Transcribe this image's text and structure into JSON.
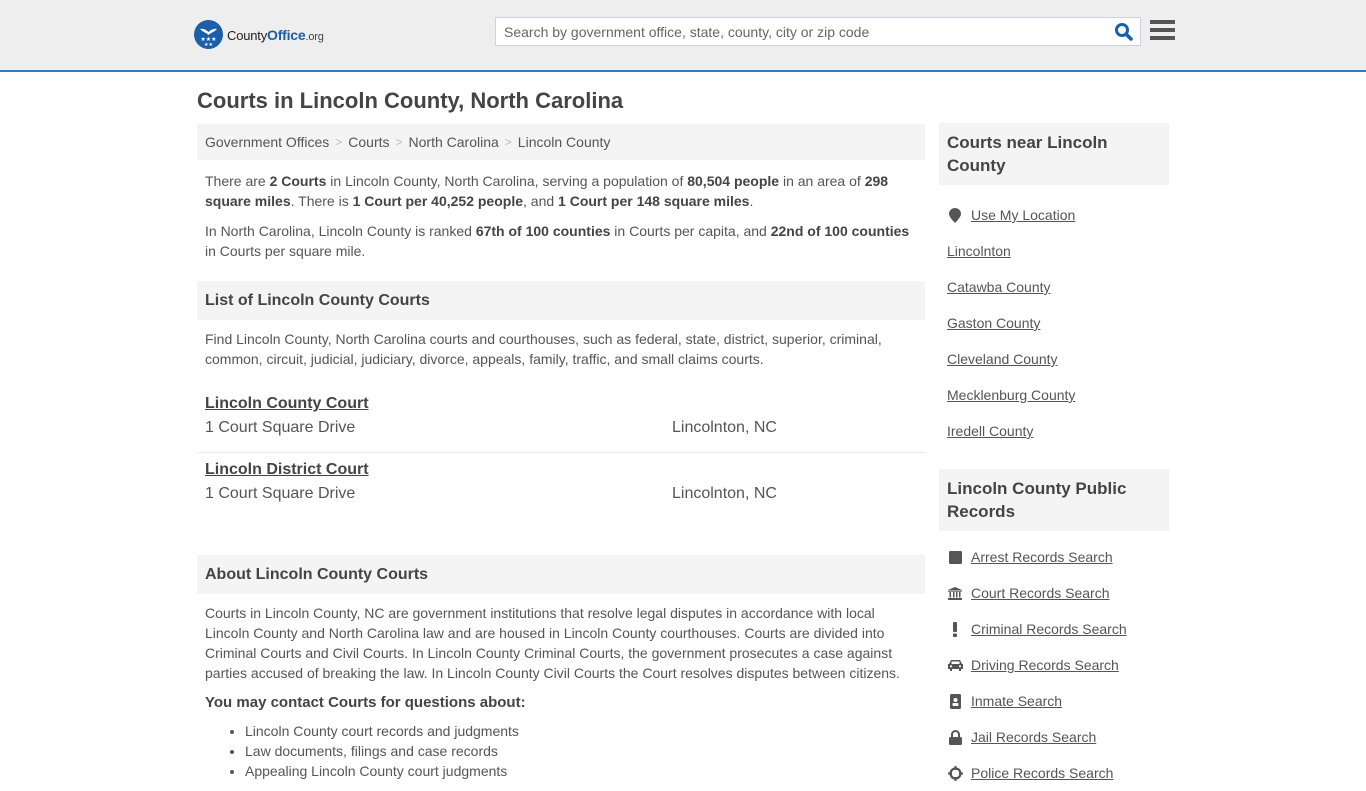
{
  "header": {
    "logo": {
      "county": "County",
      "office": "Office",
      "org": ".org"
    },
    "search_placeholder": "Search by government office, state, county, city or zip code",
    "accent_color": "#1a5fa8"
  },
  "page_title": "Courts in Lincoln County, North Carolina",
  "breadcrumb": [
    {
      "label": "Government Offices"
    },
    {
      "label": "Courts"
    },
    {
      "label": "North Carolina"
    },
    {
      "label": "Lincoln County"
    }
  ],
  "summary": {
    "p1": {
      "t1": "There are ",
      "b1": "2 Courts",
      "t2": " in Lincoln County, North Carolina, serving a population of ",
      "b2": "80,504 people",
      "t3": " in an area of ",
      "b3": "298 square miles",
      "t4": ". There is ",
      "b4": "1 Court per 40,252 people",
      "t5": ", and ",
      "b5": "1 Court per 148 square miles",
      "t6": "."
    },
    "p2": {
      "t1": "In North Carolina, Lincoln County is ranked ",
      "b1": "67th of 100 counties",
      "t2": " in Courts per capita, and ",
      "b2": "22nd of 100 counties",
      "t3": " in Courts per square mile."
    }
  },
  "list_section": {
    "title": "List of Lincoln County Courts",
    "intro": "Find Lincoln County, North Carolina courts and courthouses, such as federal, state, district, superior, criminal, common, circuit, judicial, judiciary, divorce, appeals, family, traffic, and small claims courts.",
    "courts": [
      {
        "name": "Lincoln County Court",
        "address": "1 Court Square Drive",
        "city": "Lincolnton, NC"
      },
      {
        "name": "Lincoln District Court",
        "address": "1 Court Square Drive",
        "city": "Lincolnton, NC"
      }
    ]
  },
  "about_section": {
    "title": "About Lincoln County Courts",
    "text": "Courts in Lincoln County, NC are government institutions that resolve legal disputes in accordance with local Lincoln County and North Carolina law and are housed in Lincoln County courthouses. Courts are divided into Criminal Courts and Civil Courts. In Lincoln County Criminal Courts, the government prosecutes a case against parties accused of breaking the law. In Lincoln County Civil Courts the Court resolves disputes between citizens.",
    "contact_heading": "You may contact Courts for questions about:",
    "topics": [
      "Lincoln County court records and judgments",
      "Law documents, filings and case records",
      "Appealing Lincoln County court judgments"
    ]
  },
  "sidebar": {
    "nearby_title": "Courts near Lincoln County",
    "use_location": "Use My Location",
    "nearby": [
      "Lincolnton",
      "Catawba County",
      "Gaston County",
      "Cleveland County",
      "Mecklenburg County",
      "Iredell County"
    ],
    "records_title": "Lincoln County Public Records",
    "records": [
      {
        "label": "Arrest Records Search",
        "icon": "square-icon"
      },
      {
        "label": "Court Records Search",
        "icon": "courthouse-icon"
      },
      {
        "label": "Criminal Records Search",
        "icon": "exclamation-icon"
      },
      {
        "label": "Driving Records Search",
        "icon": "car-icon"
      },
      {
        "label": "Inmate Search",
        "icon": "id-badge-icon"
      },
      {
        "label": "Jail Records Search",
        "icon": "lock-icon"
      },
      {
        "label": "Police Records Search",
        "icon": "crosshairs-icon"
      }
    ]
  }
}
